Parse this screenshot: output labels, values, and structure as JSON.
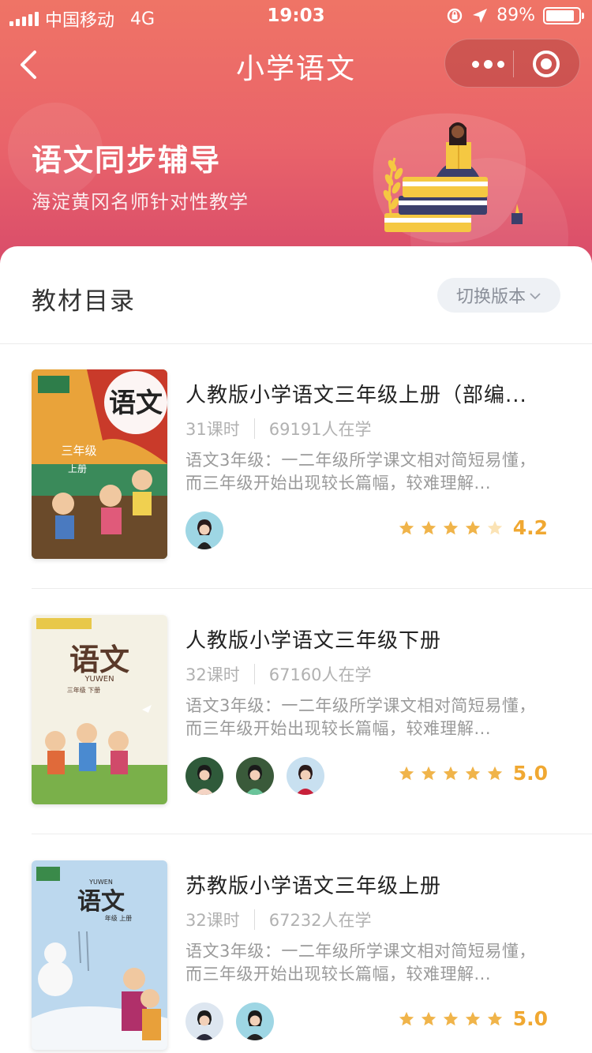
{
  "status_bar": {
    "carrier": "中国移动",
    "network": "4G",
    "time": "19:03",
    "battery": "89%"
  },
  "nav": {
    "title": "小学语文"
  },
  "banner": {
    "title": "语文同步辅导",
    "subtitle": "海淀黄冈名师针对性教学"
  },
  "catalog": {
    "title": "教材目录",
    "switch_label": "切换版本"
  },
  "books": [
    {
      "title": "人教版小学语文三年级上册（部编...",
      "lessons": "31课时",
      "learners": "69191人在学",
      "desc": "语文3年级：一二年级所学课文相对简短易懂，而三年级开始出现较长篇幅，较难理解...",
      "rating": "4.2",
      "cover_text": "语文",
      "cover_sub": "三年级",
      "cover_sub2": "上册"
    },
    {
      "title": "人教版小学语文三年级下册",
      "lessons": "32课时",
      "learners": "67160人在学",
      "desc": "语文3年级：一二年级所学课文相对简短易懂，而三年级开始出现较长篇幅，较难理解...",
      "rating": "5.0",
      "cover_text": "语文",
      "cover_sub": "YUWEN",
      "cover_sub2": "三年级 下册"
    },
    {
      "title": "苏教版小学语文三年级上册",
      "lessons": "32课时",
      "learners": "67232人在学",
      "desc": "语文3年级：一二年级所学课文相对简短易懂，而三年级开始出现较长篇幅，较难理解...",
      "rating": "5.0",
      "cover_text": "语文",
      "cover_sub": "YUWEN",
      "cover_sub2": "年级 上册"
    }
  ],
  "colors": {
    "header_top": "#ef7466",
    "header_bottom": "#d84b6a",
    "star": "#f0b44a",
    "score": "#f0a832"
  }
}
